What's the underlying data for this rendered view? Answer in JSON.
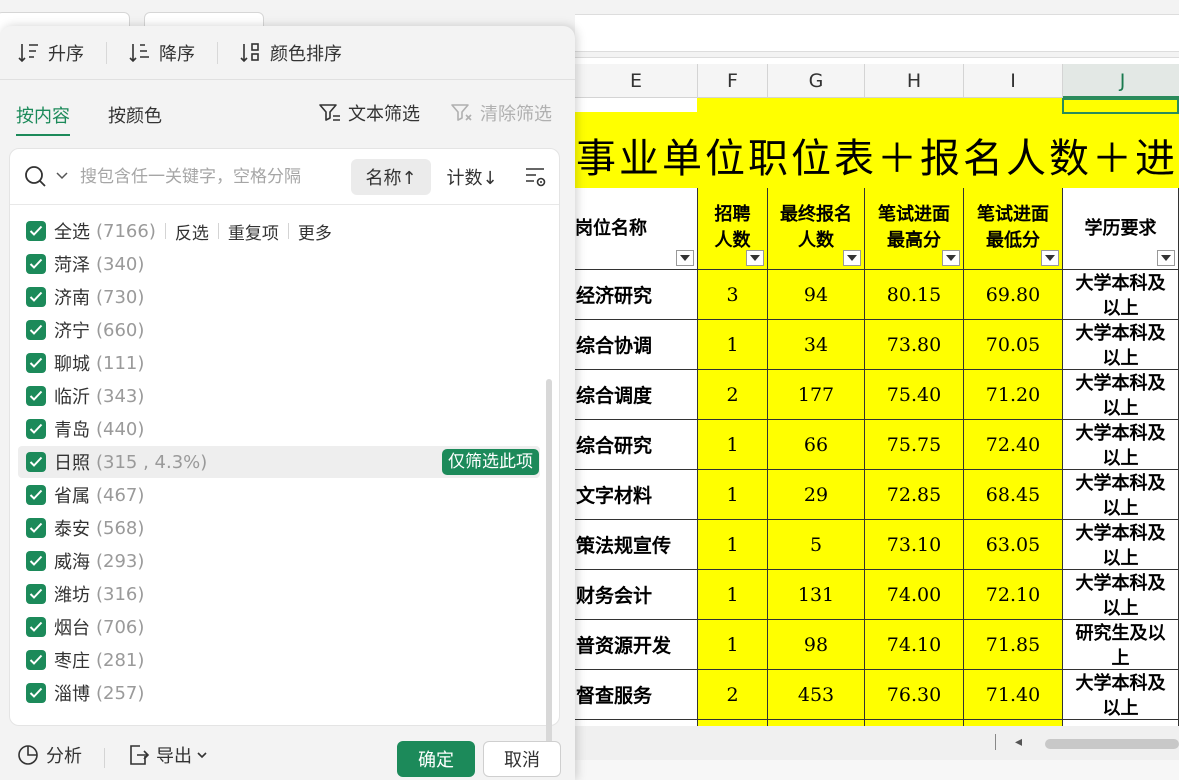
{
  "sort_bar": {
    "asc_label": "升序",
    "desc_label": "降序",
    "color_label": "颜色排序"
  },
  "tabs": {
    "by_content": "按内容",
    "by_color": "按颜色",
    "text_filter": "文本筛选",
    "clear_filter": "清除筛选"
  },
  "search": {
    "placeholder": "搜包含任一关键字，空格分隔",
    "sort_name": "名称↑",
    "sort_count": "计数↓"
  },
  "select_all": {
    "label": "全选",
    "count": "(7166)",
    "invert": "反选",
    "duplicates": "重复项",
    "more": "更多"
  },
  "items": [
    {
      "label": "菏泽",
      "count": "(340)"
    },
    {
      "label": "济南",
      "count": "(730)"
    },
    {
      "label": "济宁",
      "count": "(660)"
    },
    {
      "label": "聊城",
      "count": "(111)"
    },
    {
      "label": "临沂",
      "count": "(343)"
    },
    {
      "label": "青岛",
      "count": "(440)"
    },
    {
      "label": "日照",
      "count": "(315 , 4.3%)"
    },
    {
      "label": "省属",
      "count": "(467)"
    },
    {
      "label": "泰安",
      "count": "(568)"
    },
    {
      "label": "威海",
      "count": "(293)"
    },
    {
      "label": "潍坊",
      "count": "(316)"
    },
    {
      "label": "烟台",
      "count": "(706)"
    },
    {
      "label": "枣庄",
      "count": "(281)"
    },
    {
      "label": "淄博",
      "count": "(257)"
    }
  ],
  "only_this": "仅筛选此项",
  "footer": {
    "analyze": "分析",
    "export": "导出",
    "ok": "确定",
    "cancel": "取消"
  },
  "sheet": {
    "columns": [
      "E",
      "F",
      "G",
      "H",
      "I",
      "J"
    ],
    "title": "省事业单位职位表＋报名人数＋进",
    "headers": {
      "name": "岗位名称",
      "recruit": [
        "招聘",
        "人数"
      ],
      "applicants": [
        "最终报名",
        "人数"
      ],
      "max": [
        "笔试进面",
        "最高分"
      ],
      "min": [
        "笔试进面",
        "最低分"
      ],
      "edu": "学历要求"
    },
    "rows": [
      {
        "name": "经济研究",
        "recruit": "3",
        "applicants": "94",
        "max": "80.15",
        "min": "69.80",
        "edu": [
          "大学本科及",
          "以上"
        ]
      },
      {
        "name": "综合协调",
        "recruit": "1",
        "applicants": "34",
        "max": "73.80",
        "min": "70.05",
        "edu": [
          "大学本科及",
          "以上"
        ]
      },
      {
        "name": "综合调度",
        "recruit": "2",
        "applicants": "177",
        "max": "75.40",
        "min": "71.20",
        "edu": [
          "大学本科及",
          "以上"
        ]
      },
      {
        "name": "综合研究",
        "recruit": "1",
        "applicants": "66",
        "max": "75.75",
        "min": "72.40",
        "edu": [
          "大学本科及",
          "以上"
        ]
      },
      {
        "name": "文字材料",
        "recruit": "1",
        "applicants": "29",
        "max": "72.85",
        "min": "68.45",
        "edu": [
          "大学本科及",
          "以上"
        ]
      },
      {
        "name": "策法规宣传",
        "recruit": "1",
        "applicants": "5",
        "max": "73.10",
        "min": "63.05",
        "edu": [
          "大学本科及",
          "以上"
        ]
      },
      {
        "name": "财务会计",
        "recruit": "1",
        "applicants": "131",
        "max": "74.00",
        "min": "72.10",
        "edu": [
          "大学本科及",
          "以上"
        ]
      },
      {
        "name": "普资源开发",
        "recruit": "1",
        "applicants": "98",
        "max": "74.10",
        "min": "71.85",
        "edu": [
          "研究生及以",
          "上"
        ]
      },
      {
        "name": "督查服务",
        "recruit": "2",
        "applicants": "453",
        "max": "76.30",
        "min": "71.40",
        "edu": [
          "大学本科及",
          "以上"
        ]
      }
    ]
  },
  "colors": {
    "accent": "#1c8a5a",
    "highlight": "#ffff00"
  }
}
